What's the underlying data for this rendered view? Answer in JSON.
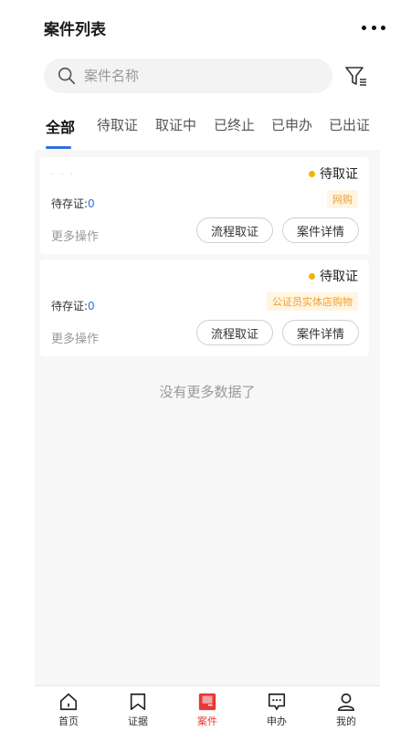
{
  "header": {
    "title": "案件列表"
  },
  "search": {
    "placeholder": "案件名称"
  },
  "tabs": [
    {
      "label": "全部",
      "active": true
    },
    {
      "label": "待取证"
    },
    {
      "label": "取证中"
    },
    {
      "label": "已终止"
    },
    {
      "label": "已申办"
    },
    {
      "label": "已出证"
    }
  ],
  "cases": [
    {
      "status": "待取证",
      "tag": "网购",
      "pending_label": "待存证:",
      "pending_count": "0",
      "more_ops": "更多操作",
      "btn_flow": "流程取证",
      "btn_detail": "案件详情"
    },
    {
      "status": "待取证",
      "tag": "公证员实体店购物",
      "pending_label": "待存证:",
      "pending_count": "0",
      "more_ops": "更多操作",
      "btn_flow": "流程取证",
      "btn_detail": "案件详情"
    }
  ],
  "no_more": "没有更多数据了",
  "tabbar": [
    {
      "label": "首页",
      "icon": "home-icon"
    },
    {
      "label": "证据",
      "icon": "bookmark-icon"
    },
    {
      "label": "案件",
      "icon": "case-icon",
      "active": true
    },
    {
      "label": "申办",
      "icon": "message-icon"
    },
    {
      "label": "我的",
      "icon": "user-icon"
    }
  ],
  "colors": {
    "accent": "#2f6fde",
    "active_nav": "#e53935",
    "status_dot": "#f0b400",
    "tag_text": "#f0a030"
  }
}
